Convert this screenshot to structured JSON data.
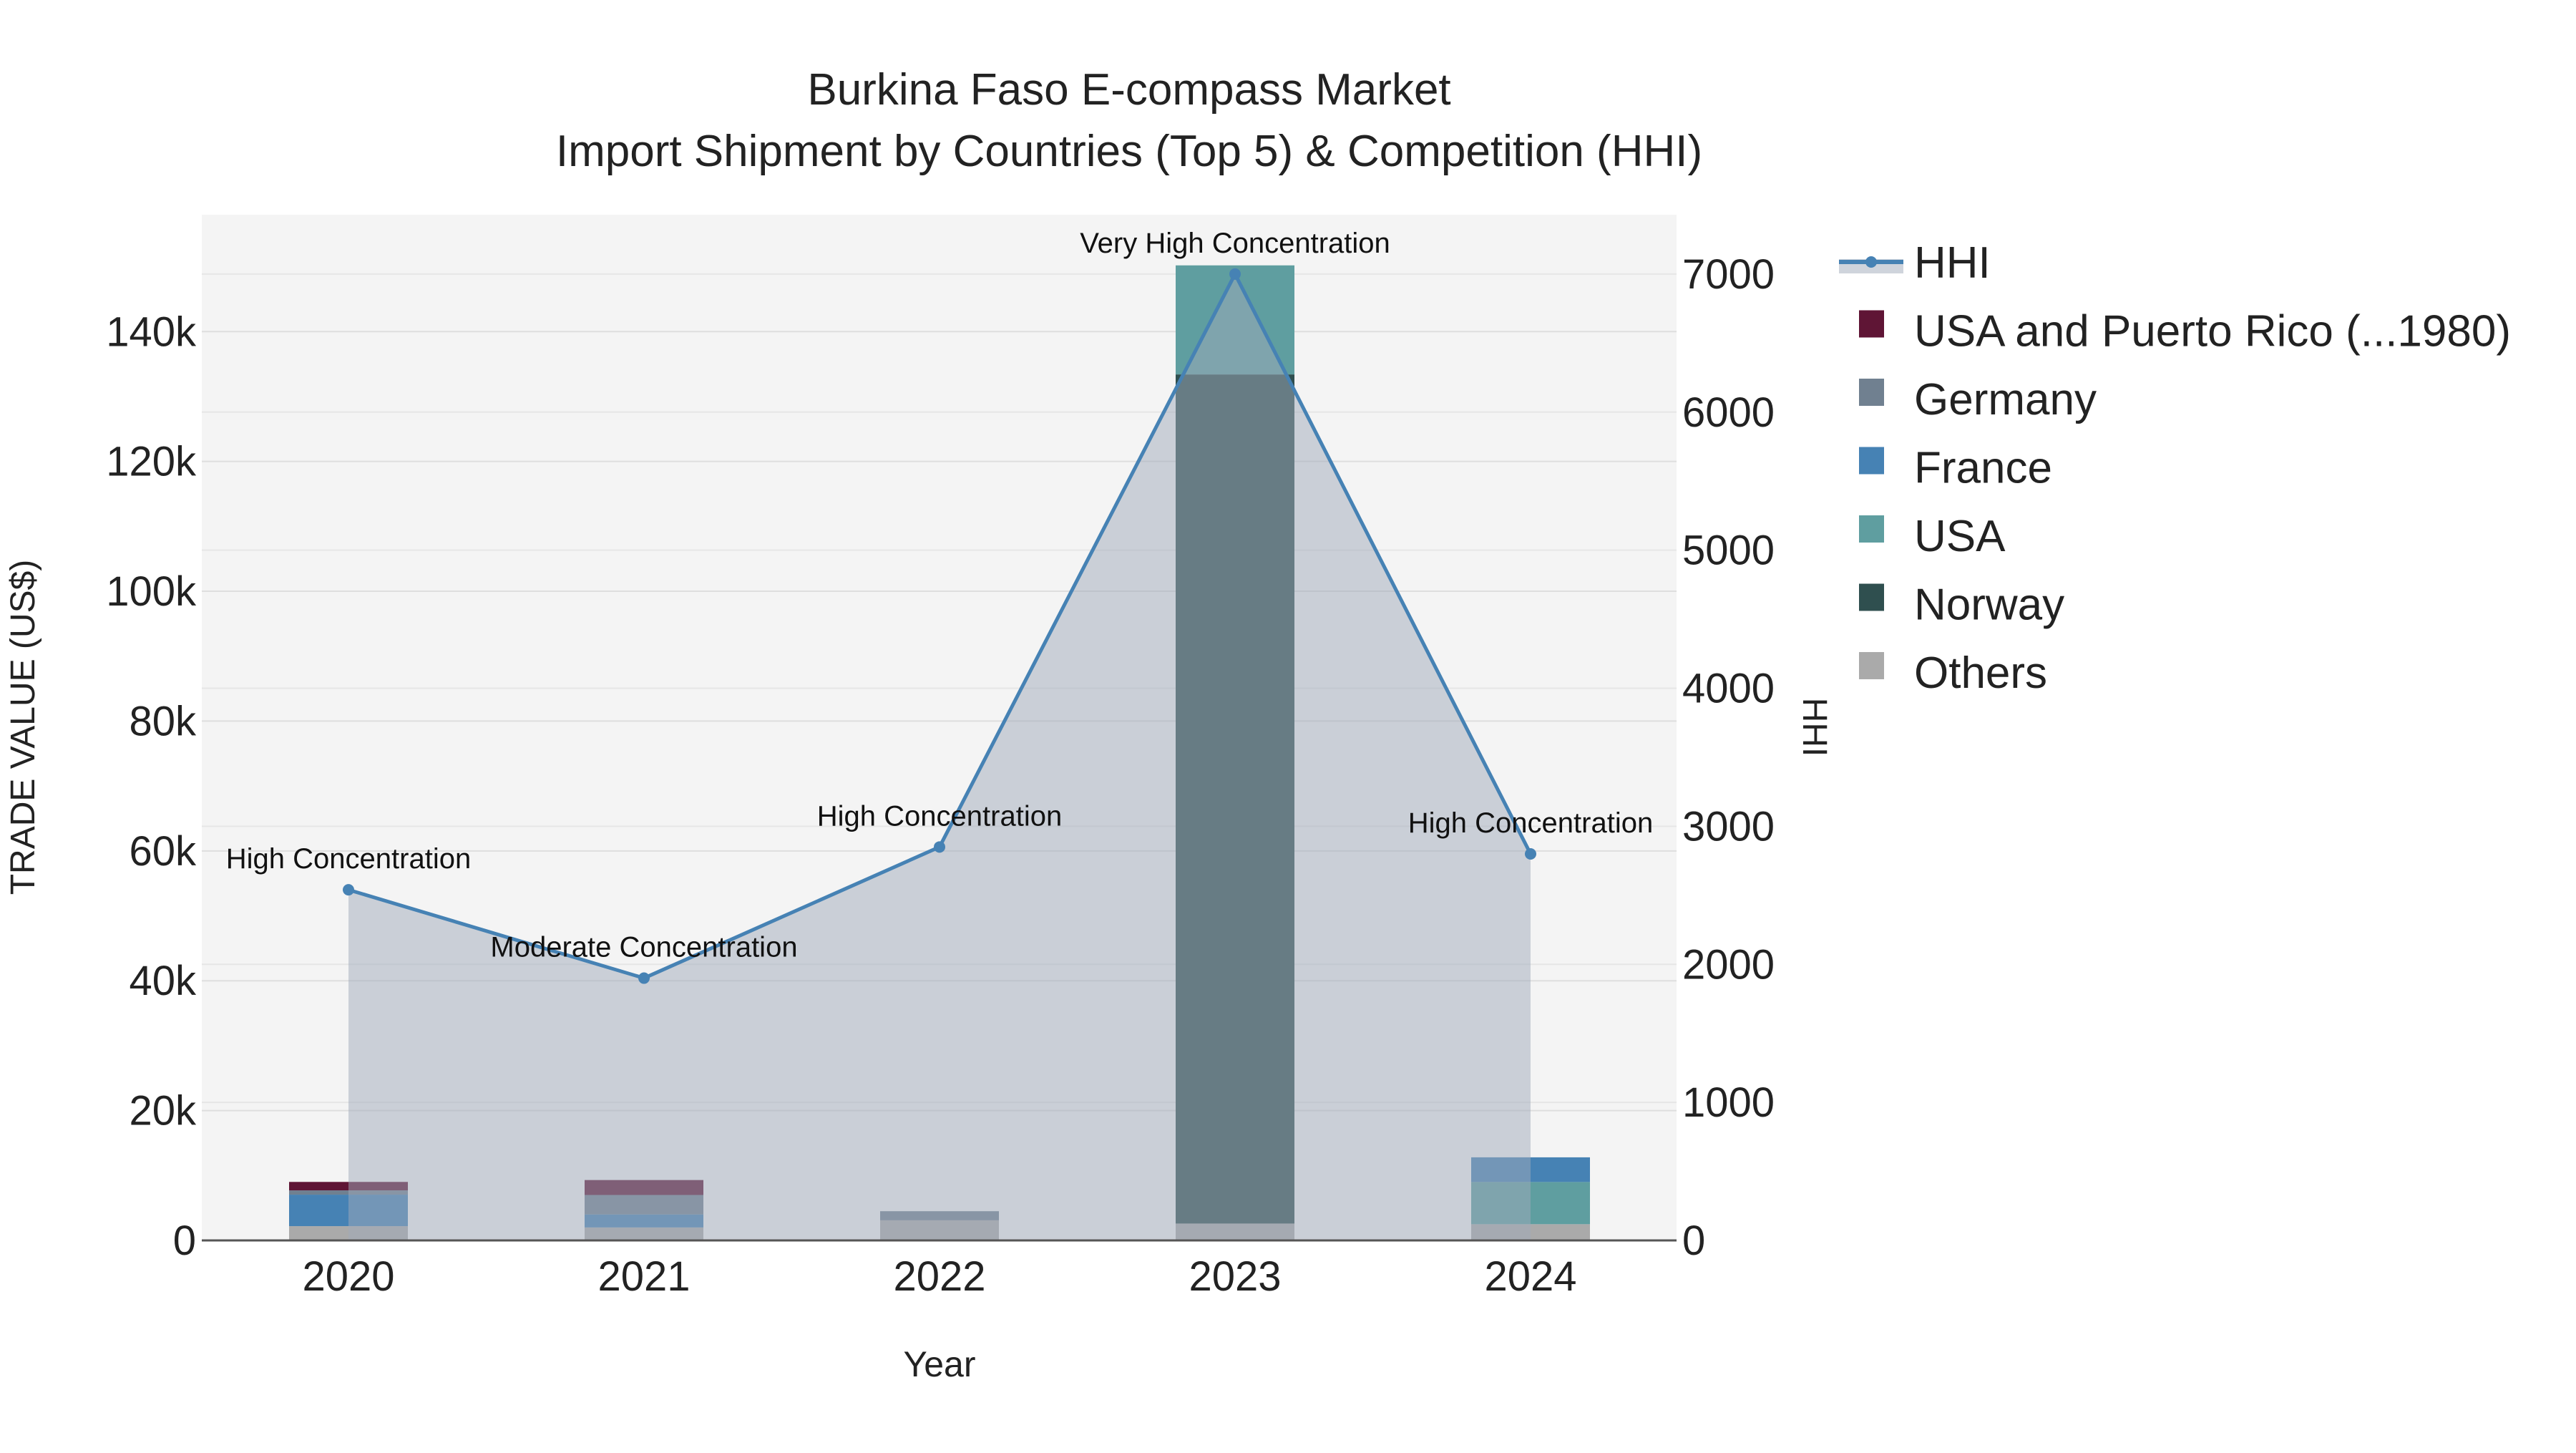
{
  "chart_data": {
    "type": "bar",
    "title": "Burkina Faso E-compass Market",
    "subtitle": "Import Shipment by Countries (Top 5) & Competition (HHI)",
    "xlabel": "Year",
    "ylabel": "TRADE VALUE (US$)",
    "y2label": "HHI",
    "categories": [
      "2020",
      "2021",
      "2022",
      "2023",
      "2024"
    ],
    "ylim": [
      0,
      158000
    ],
    "y2lim": [
      0,
      7430
    ],
    "yticks": [
      0,
      20000,
      40000,
      60000,
      80000,
      100000,
      120000,
      140000
    ],
    "ytick_labels": [
      "0",
      "20k",
      "40k",
      "60k",
      "80k",
      "100k",
      "120k",
      "140k"
    ],
    "y2ticks": [
      0,
      1000,
      2000,
      3000,
      4000,
      5000,
      6000,
      7000
    ],
    "y2tick_labels": [
      "0",
      "1000",
      "2000",
      "3000",
      "4000",
      "5000",
      "6000",
      "7000"
    ],
    "stacked": true,
    "grid": true,
    "legend_position": "right",
    "series": [
      {
        "name": "Others",
        "color": "#aaaaaa",
        "values": [
          2200,
          2000,
          3100,
          2600,
          2500
        ]
      },
      {
        "name": "Norway",
        "color": "#2f4f4f",
        "values": [
          0,
          0,
          0,
          130800,
          0
        ]
      },
      {
        "name": "USA",
        "color": "#5f9ea0",
        "values": [
          0,
          0,
          0,
          16800,
          6500
        ]
      },
      {
        "name": "France",
        "color": "#4682b4",
        "values": [
          4850,
          2000,
          0,
          0,
          3800
        ]
      },
      {
        "name": "Germany",
        "color": "#708090",
        "values": [
          660,
          3000,
          1400,
          0,
          0
        ]
      },
      {
        "name": "USA and Puerto Rico (...1980)",
        "color": "#5f1535",
        "values": [
          1300,
          2300,
          0,
          0,
          0
        ]
      }
    ],
    "hhi": {
      "name": "HHI",
      "color": "#4682b4",
      "values": [
        2540,
        1900,
        2850,
        7000,
        2800
      ],
      "annotations": [
        "High Concentration",
        "Moderate Concentration",
        "High Concentration",
        "Very High Concentration",
        "High Concentration"
      ]
    },
    "legend_order": [
      "HHI",
      "USA and Puerto Rico (...1980)",
      "Germany",
      "France",
      "USA",
      "Norway",
      "Others"
    ]
  }
}
